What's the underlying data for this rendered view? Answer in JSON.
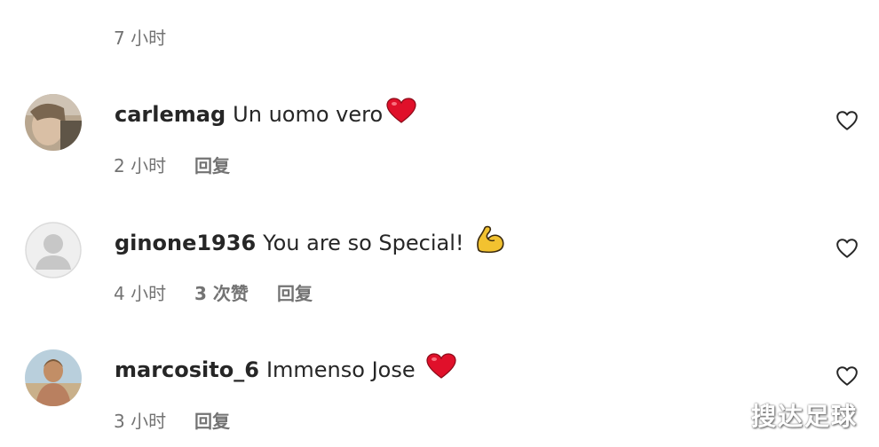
{
  "top": {
    "timestamp": "7 小时"
  },
  "comments": [
    {
      "username": "carlemag",
      "text": "Un uomo vero",
      "emoji_icon": "red-heart-emoji",
      "timestamp": "2 小时",
      "likes": "",
      "reply_label": "回复"
    },
    {
      "username": "ginone1936",
      "text": "You are so Special!",
      "emoji_icon": "flexed-biceps-emoji",
      "timestamp": "4 小时",
      "likes": "3 次赞",
      "reply_label": "回复"
    },
    {
      "username": "marcosito_6",
      "text": "Immenso Jose",
      "emoji_icon": "red-heart-emoji",
      "timestamp": "3 小时",
      "likes": "",
      "reply_label": "回复"
    }
  ],
  "watermark": "搜达足球",
  "colors": {
    "meta_text": "#737373",
    "primary_text": "#262626",
    "heart_emoji": "#e0102a",
    "biceps_emoji": "#f2c230"
  }
}
